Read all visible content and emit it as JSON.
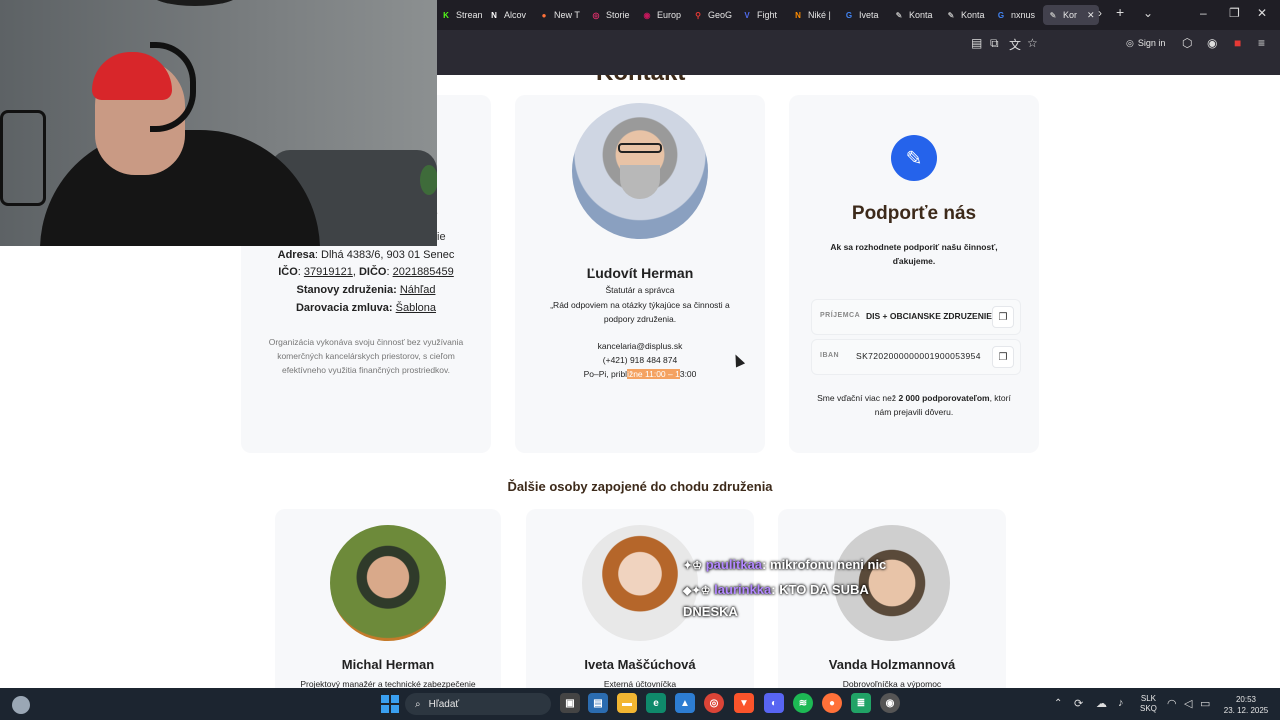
{
  "browser": {
    "tabs": [
      {
        "label": "Strean",
        "icon": "kick-icon",
        "color": "#53fc18"
      },
      {
        "label": "Alcov",
        "icon": "notion-icon",
        "color": "#ffffff"
      },
      {
        "label": "New T",
        "icon": "firefox-icon",
        "color": "#ff7139"
      },
      {
        "label": "Storie",
        "icon": "instagram-icon",
        "color": "#e1306c"
      },
      {
        "label": "Europ",
        "icon": "europa-icon",
        "color": "#c2185b"
      },
      {
        "label": "GeoG",
        "icon": "map-pin-icon",
        "color": "#e53935"
      },
      {
        "label": "Fight",
        "icon": "v-icon",
        "color": "#4f6bed"
      },
      {
        "label": "Niké |",
        "icon": "nike-icon",
        "color": "#ff8c00"
      },
      {
        "label": "Iveta",
        "icon": "google-icon",
        "color": "#4285f4"
      },
      {
        "label": "Konta",
        "icon": "feather-icon",
        "color": "#b0b0b0"
      },
      {
        "label": "Konta",
        "icon": "feather-icon",
        "color": "#b0b0b0"
      },
      {
        "label": "nxnus",
        "icon": "google-icon",
        "color": "#4285f4"
      },
      {
        "label": "Kor",
        "icon": "feather-icon",
        "color": "#b0b0b0"
      }
    ],
    "sign_in": "Sign in"
  },
  "page": {
    "heading_partial": "Kontakt",
    "left_card": {
      "title_partial": "enia",
      "line_partial": "ie",
      "address_label": "Adresa",
      "address_value": ": Dlhá 4383/6, 903 01 Senec",
      "ico_label": "IČO",
      "ico_value": "37919121",
      "dic_label": "DIČO",
      "dic_value": "2021885459",
      "stanovy_label": "Stanovy združenia:",
      "stanovy_link": "Náhľad",
      "darovacia_label": "Darovacia zmluva:",
      "darovacia_link": "Šablona",
      "note": "Organizácia vykonáva svoju činnosť bez využívania komerčných kancelárskych priestorov, s cieľom efektívneho využitia finančných prostriedkov."
    },
    "person": {
      "name": "Ľudovít Herman",
      "role": "Štatutár a správca",
      "quote": "„Rád odpoviem na otázky týkajúce sa činnosti a podpory združenia.",
      "email": "kancelaria@displus.sk",
      "phone": "(+421) 918 484 874",
      "hours_start": "Po–Pi, pribl",
      "hours_highlight": "ižne 11:00 – 1",
      "hours_end": "3:00"
    },
    "support": {
      "title": "Podporťe nás",
      "subtitle": "Ak sa rozhodnete podporiť našu činnosť, ďakujeme.",
      "recipient_label": "PRÍJEMCA",
      "recipient_value": "DIS + OBCIANSKE ZDRUZENIE",
      "iban_label": "IBAN",
      "iban_value": "SK7202000000001900053954",
      "thanks_pre": "Sme vďační viac než ",
      "thanks_bold": "2 000 podporovateľom",
      "thanks_post": ", ktorí nám prejavili dôveru."
    },
    "others_heading": "Ďalšie osoby zapojené do chodu združenia",
    "others": [
      {
        "name": "Michal Herman",
        "role": "Projektový manažér a technické zabezpečenie"
      },
      {
        "name": "Iveta Maščúchová",
        "role": "Externá účtovníčka"
      },
      {
        "name": "Vanda Holzmannová",
        "role": "Dobrovoľníčka a výpomoc"
      }
    ]
  },
  "chat": [
    {
      "user": "paulitkaa",
      "message": ": mikrofonu neni nic",
      "color": "#b388ff"
    },
    {
      "user": "laurinkka",
      "message": ": KTO DA SUBA",
      "color": "#b388ff"
    },
    {
      "user": "",
      "message": "DNESKA",
      "color": "#ffffff"
    }
  ],
  "taskbar": {
    "search_placeholder": "Hľadať",
    "lang_top": "SLK",
    "lang_bottom": "SKQ",
    "time": "20:53",
    "date": "23. 12. 2025"
  },
  "colors": {
    "accent_blue": "#2563eb",
    "heading_brown": "#3d2a1a",
    "highlight": "#f4a261"
  }
}
